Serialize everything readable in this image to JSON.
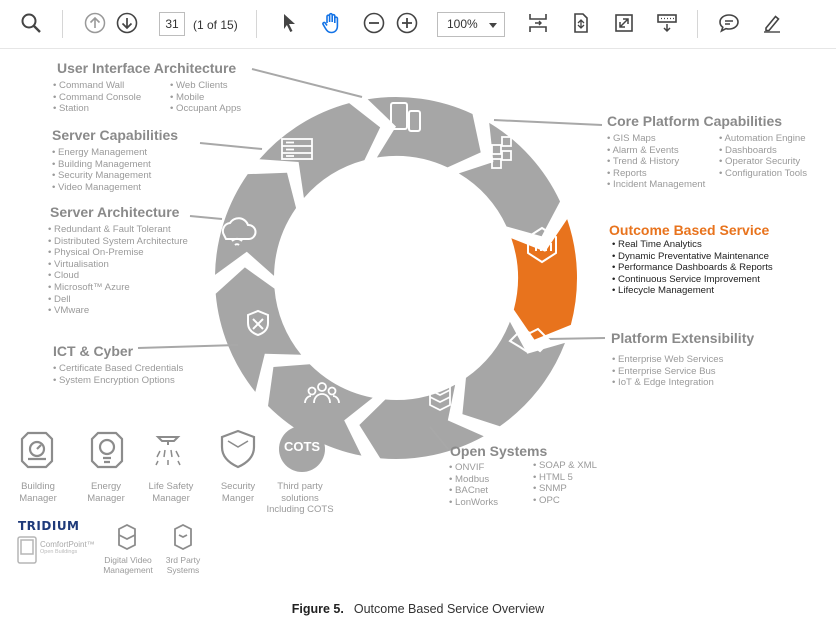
{
  "toolbar": {
    "page_current": "31",
    "page_count": "(1 of 15)",
    "zoom": "100%"
  },
  "diagram": {
    "ui_arch": {
      "title": "User Interface Architecture",
      "col1": [
        "Command Wall",
        "Command Console",
        "Station"
      ],
      "col2": [
        "Web Clients",
        "Mobile",
        "Occupant Apps"
      ]
    },
    "server_cap": {
      "title": "Server Capabilities",
      "items": [
        "Energy Management",
        "Building Management",
        "Security Management",
        "Video Management"
      ]
    },
    "server_arch": {
      "title": "Server Architecture",
      "items": [
        "Redundant & Fault Tolerant",
        "Distributed System Architecture",
        "Physical On-Premise",
        "Virtualisation",
        "Cloud",
        "Microsoft™ Azure",
        "Dell",
        "VMware"
      ]
    },
    "ict": {
      "title": "ICT & Cyber",
      "items": [
        "Certificate Based Credentials",
        "System Encryption Options"
      ]
    },
    "core": {
      "title": "Core Platform Capabilities",
      "col1": [
        "GIS Maps",
        "Alarm & Events",
        "Trend & History",
        "Reports",
        "Incident Management"
      ],
      "col2": [
        "Automation Engine",
        "Dashboards",
        "Operator Security",
        "Configuration Tools"
      ]
    },
    "outcome": {
      "title": "Outcome Based Service",
      "items": [
        "Real Time Analytics",
        "Dynamic Preventative Maintenance",
        "Performance Dashboards & Reports",
        "Continuous Service Improvement",
        "Lifecycle Management"
      ]
    },
    "extensibility": {
      "title": "Platform Extensibility",
      "items": [
        "Enterprise Web Services",
        "Enterprise Service Bus",
        "IoT & Edge Integration"
      ]
    },
    "open": {
      "title": "Open Systems",
      "col1": [
        "ONVIF",
        "Modbus",
        "BACnet",
        "LonWorks"
      ],
      "col2": [
        "SOAP & XML",
        "HTML 5",
        "SNMP",
        "OPC"
      ]
    },
    "icons_row": [
      {
        "l1": "Building",
        "l2": "Manager"
      },
      {
        "l1": "Energy",
        "l2": "Manager"
      },
      {
        "l1": "Life Safety",
        "l2": "Manager"
      },
      {
        "l1": "Security",
        "l2": "Manger"
      }
    ],
    "cots_badge": "COTS",
    "third_party": [
      "Third party",
      "solutions",
      "Including COTS"
    ],
    "tridium": "TRIDIUM",
    "comfortpoint": "ComfortPoint™",
    "comfortpoint_sub": "Open Buildings",
    "digital_video": [
      "Digital Video",
      "Management"
    ],
    "party_systems": [
      "3rd Party",
      "Systems"
    ]
  },
  "caption": {
    "label": "Figure 5.",
    "text": "Outcome Based Service Overview"
  },
  "colors": {
    "ring": "#a6a6a6",
    "accent": "#e8731d",
    "toolbar_blue": "#1473e6"
  }
}
